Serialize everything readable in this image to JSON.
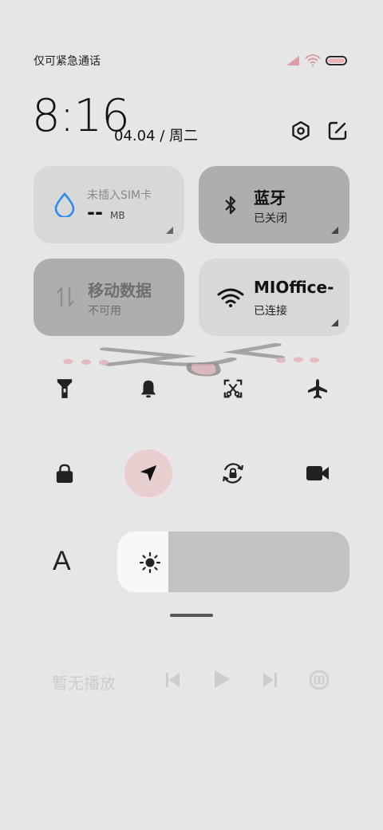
{
  "status_bar": {
    "carrier_text": "仅可紧急通话",
    "signal_icon": "signal-icon",
    "wifi_icon": "wifi-icon",
    "battery_icon": "battery-icon"
  },
  "header": {
    "time": "8:16",
    "date": "04.04 / 周二",
    "settings_icon": "settings-icon",
    "edit_icon": "edit-icon"
  },
  "tiles": {
    "data_usage": {
      "label": "未插入SIM卡",
      "value": "--",
      "unit": "MB"
    },
    "bluetooth": {
      "title": "蓝牙",
      "status": "已关闭"
    },
    "mobile_data": {
      "title": "移动数据",
      "status": "不可用"
    },
    "wifi": {
      "title": "MIOffice-",
      "status": "已连接"
    }
  },
  "toggles": [
    {
      "name": "flashlight-toggle",
      "icon": "flashlight-icon",
      "active": false
    },
    {
      "name": "silent-toggle",
      "icon": "bell-icon",
      "active": false
    },
    {
      "name": "screenshot-toggle",
      "icon": "screenshot-icon",
      "active": false
    },
    {
      "name": "airplane-toggle",
      "icon": "airplane-icon",
      "active": false
    },
    {
      "name": "lock-screen-toggle",
      "icon": "lock-icon",
      "active": false
    },
    {
      "name": "location-toggle",
      "icon": "location-arrow-icon",
      "active": true
    },
    {
      "name": "auto-rotate-toggle",
      "icon": "rotate-lock-icon",
      "active": false
    },
    {
      "name": "screen-record-toggle",
      "icon": "video-camera-icon",
      "active": false
    }
  ],
  "brightness": {
    "level_percent": 22,
    "font_size_label": "A"
  },
  "media": {
    "status": "暂无播放",
    "controls": [
      "previous-icon",
      "play-icon",
      "next-icon",
      "cast-icon"
    ]
  },
  "colors": {
    "background": "#e6e6e6",
    "tile_light": "#d8d8d8",
    "tile_dark": "#aeaeae",
    "accent_blue": "#2d8cf0",
    "location_active": "#e7cfd0"
  }
}
